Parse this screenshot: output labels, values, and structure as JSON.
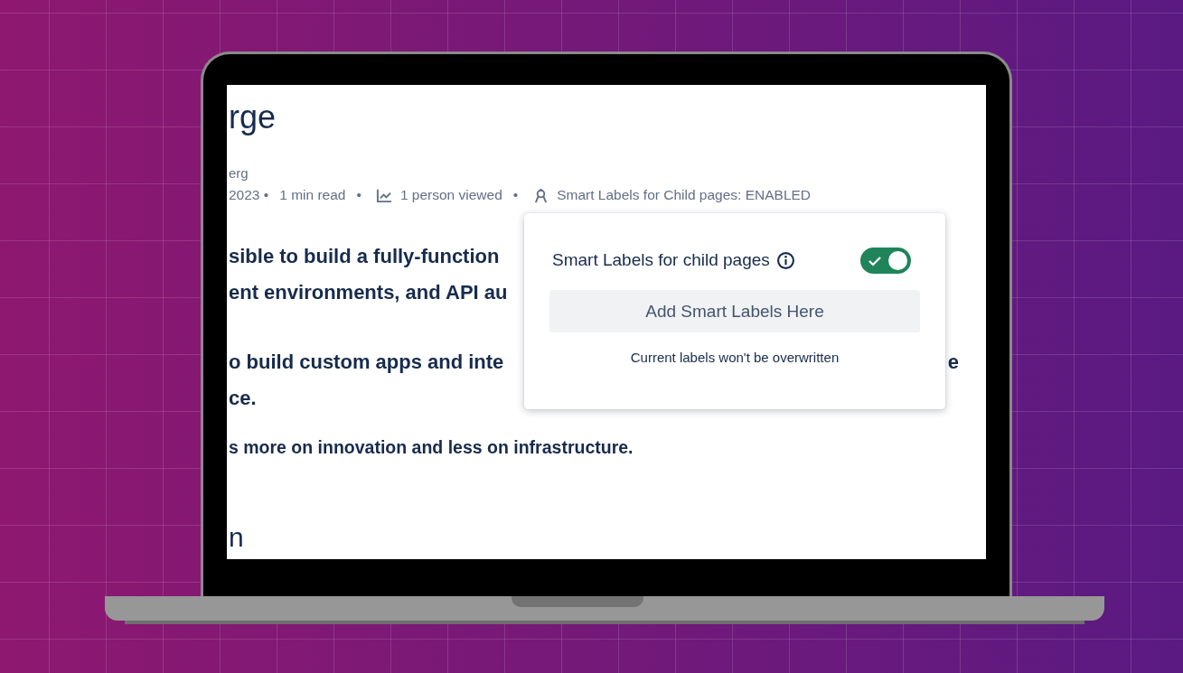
{
  "article": {
    "title": "rge",
    "author": "erg",
    "meta": [
      {
        "kind": "plain",
        "text": "2023 •"
      },
      {
        "kind": "plain",
        "text": "1 min read"
      },
      {
        "kind": "plain",
        "text": "•"
      },
      {
        "kind": "views",
        "text": "1 person viewed"
      },
      {
        "kind": "plain",
        "text": "•"
      },
      {
        "kind": "labels",
        "text": "Smart Labels for Child pages: ENABLED"
      }
    ],
    "paragraphs": [
      {
        "lines": [
          {
            "left": "sible to build a fully-function"
          },
          {
            "left": "ent environments, and API au"
          }
        ]
      },
      {
        "lines": [
          {
            "left": "o build custom apps and inte",
            "right": "e"
          },
          {
            "left": "ce."
          }
        ]
      }
    ],
    "bold_line": "s more on innovation and less on infrastructure.",
    "heading": "n"
  },
  "popup": {
    "label": "Smart Labels for child pages",
    "toggle": {
      "on": true
    },
    "button": "Add Smart Labels Here",
    "note": "Current labels won't be overwritten"
  }
}
